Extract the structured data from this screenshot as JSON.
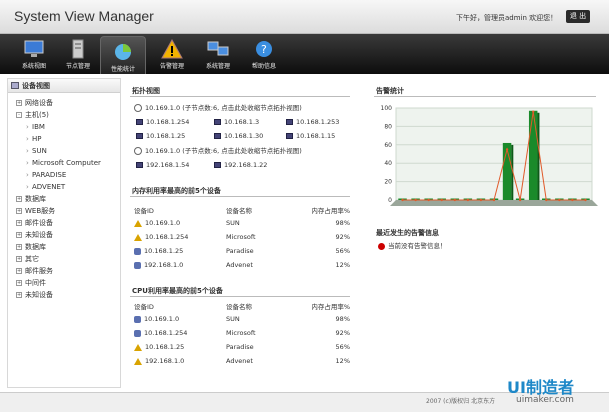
{
  "header": {
    "title": "System View Manager",
    "welcome": "下午好，管理员admin 欢迎您！",
    "exit_label": "退 出"
  },
  "nav": [
    {
      "label": "系统视图",
      "icon": "monitor-icon"
    },
    {
      "label": "节点管理",
      "icon": "server-icon"
    },
    {
      "label": "性能统计",
      "icon": "pie-chart-icon"
    },
    {
      "label": "告警管理",
      "icon": "warning-icon"
    },
    {
      "label": "系统管理",
      "icon": "computers-icon"
    },
    {
      "label": "帮助信息",
      "icon": "help-icon"
    }
  ],
  "sidebar": {
    "title": "设备视图",
    "items": [
      {
        "label": "网络设备",
        "box": "+"
      },
      {
        "label": "主机(5)",
        "box": "-"
      },
      {
        "label": "IBM",
        "child": true
      },
      {
        "label": "HP",
        "child": true
      },
      {
        "label": "SUN",
        "child": true
      },
      {
        "label": "Microsoft Computer",
        "child": true
      },
      {
        "label": "PARADISE",
        "child": true
      },
      {
        "label": "ADVENET",
        "child": true
      },
      {
        "label": "数据库",
        "box": "+"
      },
      {
        "label": "WEB服务",
        "box": "+"
      },
      {
        "label": "邮件设备",
        "box": "+"
      },
      {
        "label": "未知设备",
        "box": "+"
      },
      {
        "label": "数据库",
        "box": "+"
      },
      {
        "label": "其它",
        "box": "+"
      },
      {
        "label": "邮件服务",
        "box": "+"
      },
      {
        "label": "中间件",
        "box": "+"
      },
      {
        "label": "未知设备",
        "box": "+"
      }
    ]
  },
  "topology": {
    "title": "拓扑视图",
    "group1": "10.169.1.0 (子节点数:6, 点击此处收缩节点拓扑视图)",
    "group1_nodes": [
      "10.168.1.254",
      "10.168.1.3",
      "10.168.1.253",
      "10.168.1.25",
      "10.168.1.30",
      "10.168.1.15"
    ],
    "group2": "10.169.1.0 (子节点数:6, 点击此处收缩节点拓扑视图)",
    "group2_nodes": [
      "192.168.1.54",
      "192.168.1.22"
    ]
  },
  "memory_table": {
    "title": "内存利用率最高的前5个设备",
    "headers": [
      "设备ID",
      "设备名称",
      "内存占用率%"
    ],
    "rows": [
      {
        "id": "10.169.1.0",
        "name": "SUN",
        "rate": "98%",
        "icon": "warning-icon"
      },
      {
        "id": "10.168.1.254",
        "name": "Microsoft",
        "rate": "92%",
        "icon": "warning-icon"
      },
      {
        "id": "10.168.1.25",
        "name": "Paradise",
        "rate": "56%",
        "icon": "device-icon"
      },
      {
        "id": "192.168.1.0",
        "name": "Advenet",
        "rate": "12%",
        "icon": "device-icon"
      }
    ]
  },
  "cpu_table": {
    "title": "CPU利用率最高的前5个设备",
    "headers": [
      "设备ID",
      "设备名称",
      "内存占用率%"
    ],
    "rows": [
      {
        "id": "10.169.1.0",
        "name": "SUN",
        "rate": "98%",
        "icon": "device-icon"
      },
      {
        "id": "10.168.1.254",
        "name": "Microsoft",
        "rate": "92%",
        "icon": "device-icon"
      },
      {
        "id": "10.168.1.25",
        "name": "Paradise",
        "rate": "56%",
        "icon": "warning-icon"
      },
      {
        "id": "192.168.1.0",
        "name": "Advenet",
        "rate": "12%",
        "icon": "warning-icon"
      }
    ]
  },
  "alarm_stats": {
    "title": "告警统计",
    "recent_title": "最近发生的告警信息",
    "recent_none": "当前没有告警信息！"
  },
  "chart_data": {
    "type": "bar",
    "title": "",
    "yticks": [
      0,
      20,
      40,
      60,
      80,
      100
    ],
    "ylim": [
      0,
      100
    ],
    "bar_values": [
      0,
      0,
      0,
      0,
      0,
      0,
      0,
      0,
      62,
      0,
      97,
      0,
      0,
      0,
      0
    ],
    "line_values": [
      0,
      0,
      0,
      0,
      0,
      0,
      0,
      0,
      55,
      0,
      96,
      0,
      0,
      0,
      0
    ],
    "bar_color": "#1a8a2a",
    "line_color": "#e05a2a"
  },
  "footer": {
    "copyright": "2007 (c)版权归 北京东方",
    "watermark": "UI制造者",
    "watermark_sub": "uimaker.com"
  }
}
